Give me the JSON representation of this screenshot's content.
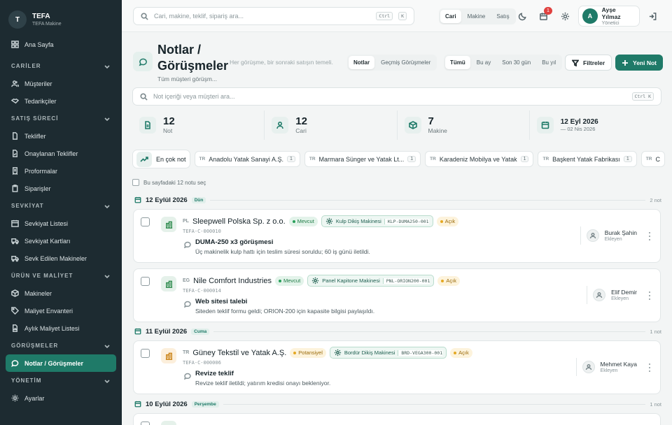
{
  "brand": {
    "initial": "T",
    "name": "TEFA",
    "subtitle": "TEFA Makine"
  },
  "sidebar": {
    "home": "Ana Sayfa",
    "sections": [
      {
        "title": "CARİLER",
        "items": [
          "Müşteriler",
          "Tedarikçiler"
        ]
      },
      {
        "title": "SATIŞ SÜRECİ",
        "items": [
          "Teklifler",
          "Onaylanan Teklifler",
          "Proformalar",
          "Siparişler"
        ]
      },
      {
        "title": "SEVKİYAT",
        "items": [
          "Sevkiyat Listesi",
          "Sevkiyat Kartları",
          "Sevk Edilen Makineler"
        ]
      },
      {
        "title": "ÜRÜN VE MALİYET",
        "items": [
          "Makineler",
          "Maliyet Envanteri",
          "Aylık Maliyet Listesi"
        ]
      },
      {
        "title": "GÖRÜŞMELER",
        "items": [
          "Notlar / Görüşmeler"
        ]
      },
      {
        "title": "YÖNETİM",
        "items": [
          "Ayarlar"
        ]
      }
    ]
  },
  "topbar": {
    "search_placeholder": "Cari, makine, teklif, sipariş ara...",
    "kbd1": "Ctrl",
    "kbd2": "K",
    "scope": [
      "Cari",
      "Makine",
      "Satış"
    ],
    "notif_count": "1",
    "user": {
      "initial": "A",
      "name": "Ayşe Yılmaz",
      "role": "Yönetici"
    }
  },
  "page": {
    "title": "Notlar / Görüşmeler",
    "subtitle": "Tüm müşteri görüşm...",
    "description": "Her görüşme, bir sonraki satışın temeli.",
    "view_tabs": [
      "Notlar",
      "Geçmiş Görüşmeler"
    ],
    "period_tabs": [
      "Tümü",
      "Bu ay",
      "Son 30 gün",
      "Bu yıl"
    ],
    "filter_label": "Filtreler",
    "new_label": "Yeni Not",
    "note_search_placeholder": "Not içeriği veya müşteri ara...",
    "note_search_kbd": "Ctrl K"
  },
  "stats": [
    {
      "value": "12",
      "label": "Not",
      "icon": "file-text-icon"
    },
    {
      "value": "12",
      "label": "Cari",
      "icon": "user-icon"
    },
    {
      "value": "7",
      "label": "Makine",
      "icon": "box-icon"
    },
    {
      "value": "12 Eyl 2026",
      "label": "— 02 Nis 2026",
      "icon": "calendar-icon"
    }
  ],
  "top_customers": {
    "label": "En çok not",
    "items": [
      {
        "cc": "TR",
        "name": "Anadolu Yatak Sanayi A.Ş.",
        "count": "1"
      },
      {
        "cc": "TR",
        "name": "Marmara Sünger ve Yatak Lt...",
        "count": "1"
      },
      {
        "cc": "TR",
        "name": "Karadeniz Mobilya ve Yatak",
        "count": "1"
      },
      {
        "cc": "TR",
        "name": "Başkent Yatak Fabrikası",
        "count": "1"
      },
      {
        "cc": "TR",
        "name": "C",
        "count": ""
      }
    ]
  },
  "select_all": "Bu sayfadaki 12 notu seç",
  "days": [
    {
      "date": "12 Eylül 2026",
      "badge": "Dün",
      "count": "2 not"
    },
    {
      "date": "11 Eylül 2026",
      "badge": "Cuma",
      "count": "1 not"
    },
    {
      "date": "10 Eylül 2026",
      "badge": "Perşembe",
      "count": "1 not"
    }
  ],
  "notes": [
    {
      "cc": "PL",
      "name": "Sleepwell Polska Sp. z o.o.",
      "status": "Mevcut",
      "machine": "Kulp Dikiş Makinesi",
      "machine_code": "KLP-DUMA250-001",
      "state": "Açık",
      "id": "TEFA-C-000010",
      "title": "DUMA-250 x3 görüşmesi",
      "text": "Üç makinelik kulp hattı için teslim süresi soruldu; 60 iş günü iletildi.",
      "author": "Burak Şahin",
      "author_role": "Ekleyen"
    },
    {
      "cc": "EG",
      "name": "Nile Comfort Industries",
      "status": "Mevcut",
      "machine": "Panel Kapitone Makinesi",
      "machine_code": "PNL-ORION200-001",
      "state": "Açık",
      "id": "TEFA-C-000014",
      "title": "Web sitesi talebi",
      "text": "Siteden teklif formu geldi; ORION-200 için kapasite bilgisi paylaşıldı.",
      "author": "Elif Demir",
      "author_role": "Ekleyen"
    },
    {
      "cc": "TR",
      "name": "Güney Tekstil ve Yatak A.Ş.",
      "status": "Potansiyel",
      "machine": "Bordür Dikiş Makinesi",
      "machine_code": "BRD-VEGA300-001",
      "state": "Açık",
      "id": "TEFA-C-000006",
      "title": "Revize teklif",
      "text": "Revize teklif iletildi; yatırım kredisi onayı bekleniyor.",
      "author": "Mehmet Kaya",
      "author_role": "Ekleyen"
    }
  ],
  "colors": {
    "accent": "#1f7a68",
    "sidebar_bg": "#1d2b31",
    "status_green": "#28a05a",
    "status_yellow": "#e5a822"
  }
}
